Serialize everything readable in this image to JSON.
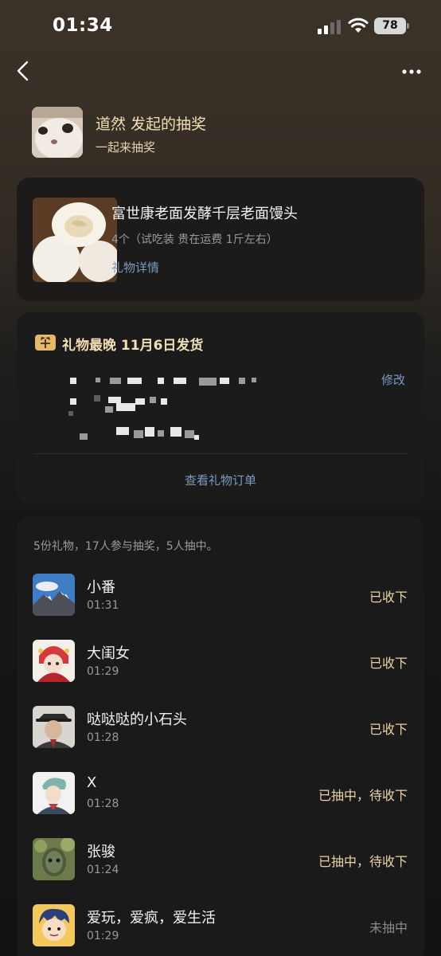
{
  "status_bar": {
    "time": "01:34",
    "battery": "78"
  },
  "host": {
    "title": "道然 发起的抽奖",
    "subtitle": "一起来抽奖"
  },
  "product": {
    "name": "富世康老面发酵千层老面馒头",
    "spec": "4个（试吃装 贵在运费 1斤左右）",
    "detail_link": "礼物详情"
  },
  "delivery": {
    "title": "礼物最晚 11月6日发货",
    "modify": "修改",
    "view_order": "查看礼物订单"
  },
  "winners": {
    "summary": "5份礼物，17人参与抽奖，5人抽中。",
    "rows": [
      {
        "name": "小番",
        "time": "01:31",
        "status": "已收下",
        "status_color": "#e9d3a6"
      },
      {
        "name": "大闺女",
        "time": "01:29",
        "status": "已收下",
        "status_color": "#e9d3a6"
      },
      {
        "name": "哒哒哒的小石头",
        "time": "01:28",
        "status": "已收下",
        "status_color": "#e9d3a6"
      },
      {
        "name": "X",
        "time": "01:28",
        "status": "已抽中，待收下",
        "status_color": "#e9d3a6"
      },
      {
        "name": "张骏",
        "time": "01:24",
        "status": "已抽中，待收下",
        "status_color": "#e9d3a6"
      },
      {
        "name": "爱玩，爱疯，爱生活",
        "time": "01:29",
        "status": "未抽中",
        "status_color": "#8a8a8a"
      }
    ]
  },
  "icons": [
    "back-icon",
    "more-icon",
    "gift-icon",
    "wifi-icon",
    "signal-icon",
    "battery-icon"
  ]
}
